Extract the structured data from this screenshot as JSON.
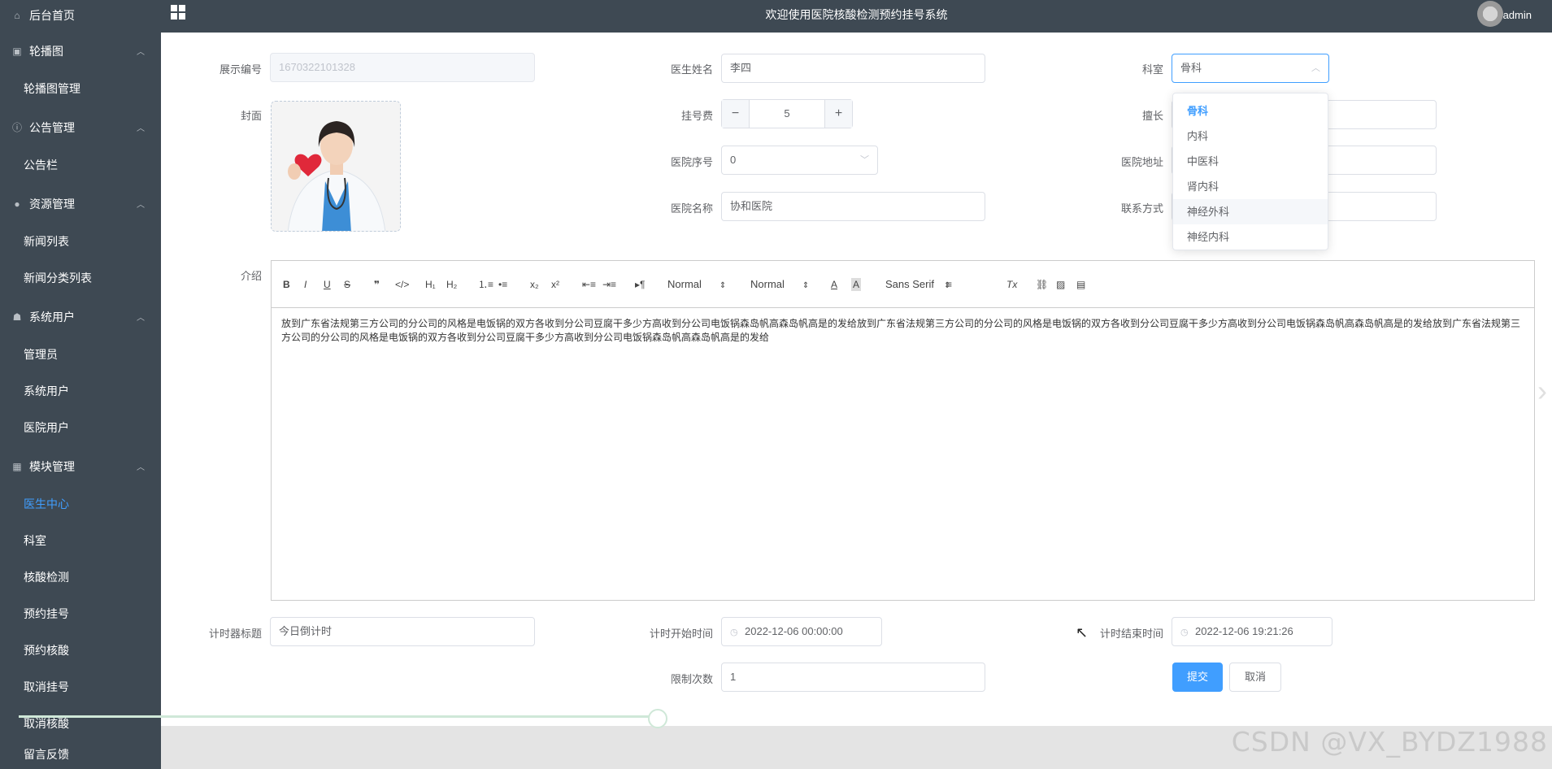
{
  "header": {
    "title": "欢迎使用医院核酸检测预约挂号系统",
    "user": "admin"
  },
  "sidebar": {
    "home": "后台首页",
    "groups": [
      {
        "label": "轮播图",
        "items": [
          "轮播图管理"
        ]
      },
      {
        "label": "公告管理",
        "items": [
          "公告栏"
        ]
      },
      {
        "label": "资源管理",
        "items": [
          "新闻列表",
          "新闻分类列表"
        ]
      },
      {
        "label": "系统用户",
        "items": [
          "管理员",
          "系统用户",
          "医院用户"
        ]
      },
      {
        "label": "模块管理",
        "items": [
          "医生中心",
          "科室",
          "核酸检测",
          "预约挂号",
          "预约核酸",
          "取消挂号",
          "取消核酸"
        ]
      }
    ],
    "partial_bottom": "留言反馈"
  },
  "form": {
    "display_no_label": "展示编号",
    "display_no_value": "1670322101328",
    "doctor_name_label": "医生姓名",
    "doctor_name_value": "李四",
    "dept_label": "科室",
    "dept_value": "骨科",
    "cover_label": "封面",
    "fee_label": "挂号费",
    "fee_value": "5",
    "specialty_label": "擅长",
    "hospital_no_label": "医院序号",
    "hospital_no_value": "0",
    "hospital_addr_label": "医院地址",
    "hospital_name_label": "医院名称",
    "hospital_name_value": "协和医院",
    "contact_label": "联系方式",
    "intro_label": "介绍",
    "timer_title_label": "计时器标题",
    "timer_title_value": "今日倒计时",
    "timer_start_label": "计时开始时间",
    "timer_start_value": "2022-12-06 00:00:00",
    "timer_end_label": "计时结束时间",
    "timer_end_value": "2022-12-06 19:21:26",
    "limit_label": "限制次数",
    "limit_value": "1",
    "submit": "提交",
    "cancel": "取消"
  },
  "dept_options": [
    "骨科",
    "内科",
    "中医科",
    "肾内科",
    "神经外科",
    "神经内科"
  ],
  "editor": {
    "header_picker": "Normal",
    "size_picker": "Normal",
    "font_picker": "Sans Serif",
    "content": "放到广东省法规第三方公司的分公司的风格是电饭锅的双方各收到分公司豆腐干多少方高收到分公司电饭锅森岛帆高森岛帆高是的发给放到广东省法规第三方公司的分公司的风格是电饭锅的双方各收到分公司豆腐干多少方高收到分公司电饭锅森岛帆高森岛帆高是的发给放到广东省法规第三方公司的分公司的风格是电饭锅的双方各收到分公司豆腐干多少方高收到分公司电饭锅森岛帆高森岛帆高是的发给"
  },
  "watermark": "CSDN @VX_BYDZ1988"
}
